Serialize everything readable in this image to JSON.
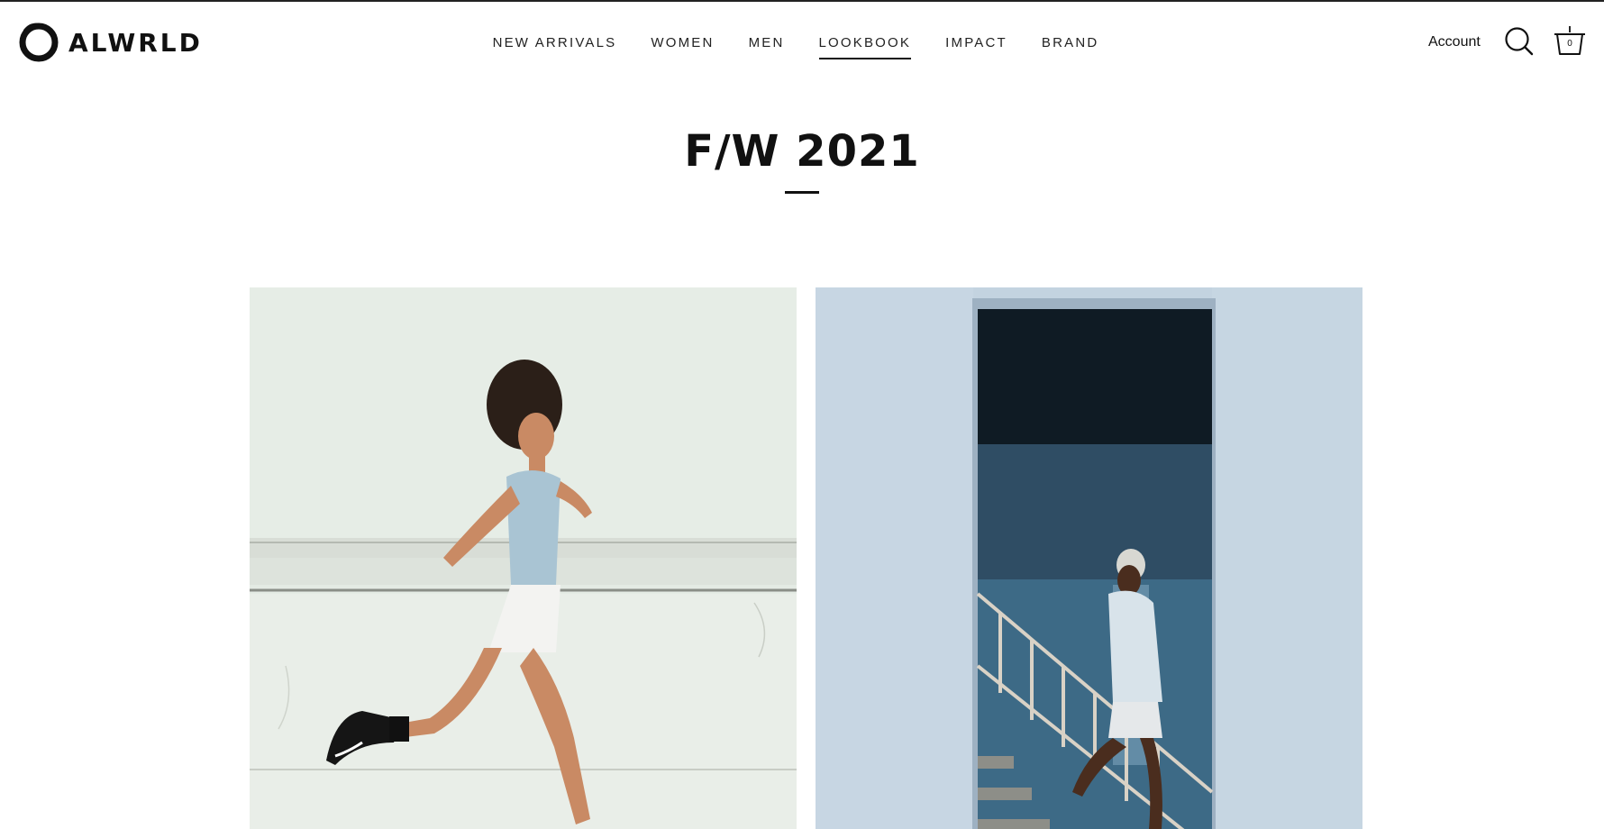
{
  "brand": {
    "name": "ALWRLD",
    "logo_icon": "brand-ring-icon"
  },
  "nav": {
    "items": [
      {
        "label": "NEW ARRIVALS"
      },
      {
        "label": "WOMEN"
      },
      {
        "label": "MEN"
      },
      {
        "label": "LOOKBOOK",
        "active": true
      },
      {
        "label": "IMPACT"
      },
      {
        "label": "BRAND"
      }
    ]
  },
  "header_actions": {
    "account_label": "Account",
    "search_icon": "search-icon",
    "cart_icon": "basket-icon",
    "cart_count": "0"
  },
  "page": {
    "title": "F/W 2021"
  },
  "gallery": {
    "images": [
      {
        "subject": "woman running",
        "icon": "photo"
      },
      {
        "subject": "man climbing stairs",
        "icon": "photo"
      }
    ]
  },
  "colors": {
    "text": "#111111",
    "background": "#ffffff",
    "accent_line": "#111111"
  }
}
